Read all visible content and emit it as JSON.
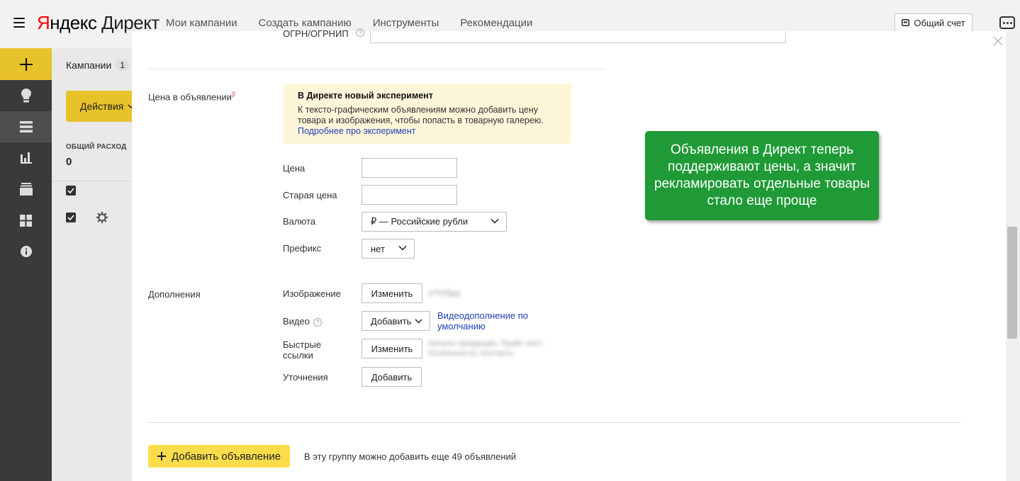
{
  "header": {
    "logo_ya": "Я",
    "logo_rest": "ндекс",
    "logo_product": "Директ",
    "nav": [
      "Мои кампании",
      "Создать кампанию",
      "Инструменты",
      "Рекомендации"
    ],
    "account_button": "Общий счет"
  },
  "sidebar": {
    "items": [
      "add",
      "recommendations",
      "campaigns",
      "statistics",
      "archive",
      "apps",
      "info"
    ]
  },
  "campaigns_panel": {
    "title": "Кампании",
    "count": "1",
    "actions_button": "Действия",
    "spend_label": "ОБЩИЙ РАСХОД",
    "spend_value": "0"
  },
  "form": {
    "ogrn_label": "ОГРН/ОГРНИП",
    "price_section_label": "Цена в объявлении",
    "beta_mark": "β",
    "experiment": {
      "title": "В Директе новый эксперимент",
      "text": "К тексто-графическим объявлениям можно добавить цену товара и изображения, чтобы попасть в товарную галерею.",
      "link": "Подробнее про эксперимент"
    },
    "price_label": "Цена",
    "old_price_label": "Старая цена",
    "currency_label": "Валюта",
    "currency_value": "₽ — Российские рубли",
    "prefix_label": "Префикс",
    "prefix_value": "нет",
    "extensions_label": "Дополнения",
    "image_label": "Изображение",
    "image_button": "Изменить",
    "image_value": "a7f1f3jpg",
    "video_label": "Видео",
    "video_button": "Добавить",
    "video_link": "Видеодополнение по умолчанию",
    "sitelinks_label": "Быстрые ссылки",
    "sitelinks_button": "Изменить",
    "sitelinks_value": "Каталог продукции, Прайс-лист, Особенности, Контакты",
    "callouts_label": "Уточнения",
    "callouts_button": "Добавить",
    "add_ad_button": "Добавить объявление",
    "add_ad_note": "В эту группу можно добавить еще 49 объявлений"
  },
  "callout": {
    "text": "Объявления в Директ теперь поддерживают цены, а значит рекламировать отдельные товары стало еще проще"
  },
  "colors": {
    "accent_yellow": "#e8c22a",
    "callout_green": "#1f9a36",
    "link_blue": "#1f3fb6",
    "sidebar_dark": "#3a3a3a"
  }
}
